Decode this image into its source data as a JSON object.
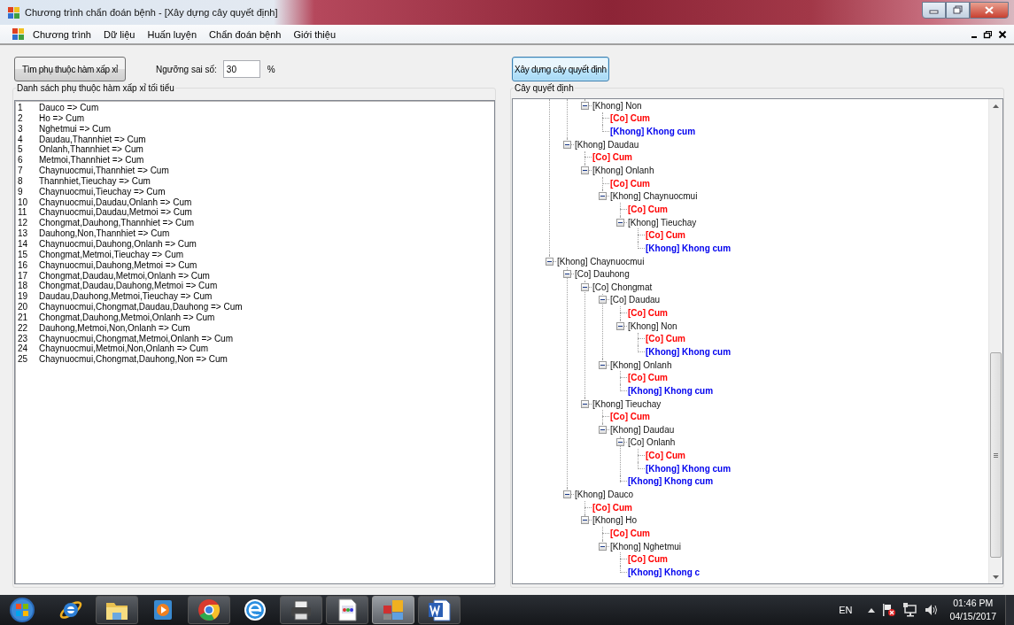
{
  "window": {
    "title": "Chương trình chẩn đoán bệnh - [Xây dựng cây quyết định]"
  },
  "menu": [
    "Chương trình",
    "Dữ liệu",
    "Huấn luyện",
    "Chẩn đoán bệnh",
    "Giới thiệu"
  ],
  "toolbar": {
    "find_button": "Tìm phụ thuộc hàm xấp xỉ",
    "threshold_label": "Ngưỡng sai số:",
    "threshold_value": "30",
    "unit": "%",
    "build_button": "Xây dựng cây quyết định"
  },
  "dependency_list": {
    "title": "Danh sách phụ thuộc hàm xấp xỉ tối tiểu",
    "rows": [
      {
        "number": "1",
        "text": "Dauco => Cum"
      },
      {
        "number": "2",
        "text": "Ho => Cum"
      },
      {
        "number": "3",
        "text": "Nghetmui => Cum"
      },
      {
        "number": "4",
        "text": "Daudau,Thannhiet => Cum"
      },
      {
        "number": "5",
        "text": "Onlanh,Thannhiet => Cum"
      },
      {
        "number": "6",
        "text": "Metmoi,Thannhiet => Cum"
      },
      {
        "number": "7",
        "text": "Chaynuocmui,Thannhiet => Cum"
      },
      {
        "number": "8",
        "text": "Thannhiet,Tieuchay => Cum"
      },
      {
        "number": "9",
        "text": "Chaynuocmui,Tieuchay => Cum"
      },
      {
        "number": "10",
        "text": "Chaynuocmui,Daudau,Onlanh => Cum"
      },
      {
        "number": "11",
        "text": "Chaynuocmui,Daudau,Metmoi => Cum"
      },
      {
        "number": "12",
        "text": "Chongmat,Dauhong,Thannhiet => Cum"
      },
      {
        "number": "13",
        "text": "Dauhong,Non,Thannhiet => Cum"
      },
      {
        "number": "14",
        "text": "Chaynuocmui,Dauhong,Onlanh => Cum"
      },
      {
        "number": "15",
        "text": "Chongmat,Metmoi,Tieuchay => Cum"
      },
      {
        "number": "16",
        "text": "Chaynuocmui,Dauhong,Metmoi => Cum"
      },
      {
        "number": "17",
        "text": "Chongmat,Daudau,Metmoi,Onlanh => Cum"
      },
      {
        "number": "18",
        "text": "Chongmat,Daudau,Dauhong,Metmoi => Cum"
      },
      {
        "number": "19",
        "text": "Daudau,Dauhong,Metmoi,Tieuchay => Cum"
      },
      {
        "number": "20",
        "text": "Chaynuocmui,Chongmat,Daudau,Dauhong => Cum"
      },
      {
        "number": "21",
        "text": "Chongmat,Dauhong,Metmoi,Onlanh => Cum"
      },
      {
        "number": "22",
        "text": "Dauhong,Metmoi,Non,Onlanh => Cum"
      },
      {
        "number": "23",
        "text": "Chaynuocmui,Chongmat,Metmoi,Onlanh => Cum"
      },
      {
        "number": "24",
        "text": "Chaynuocmui,Metmoi,Non,Onlanh => Cum"
      },
      {
        "number": "25",
        "text": "Chaynuocmui,Chongmat,Dauhong,Non => Cum"
      }
    ]
  },
  "decision_tree": {
    "title": "Cây quyết định",
    "nodes": [
      {
        "children": [
          {
            "children": [
              {
                "children": [
                  {
                    "label": "[Khong] Non",
                    "kind": "branch",
                    "expanded": true,
                    "children": [
                      {
                        "label": "[Co] Cum",
                        "kind": "yes"
                      },
                      {
                        "label": "[Khong] Khong cum",
                        "kind": "no"
                      }
                    ]
                  }
                ]
              },
              {
                "label": "[Khong] Daudau",
                "kind": "branch",
                "expanded": true,
                "children": [
                  {
                    "label": "[Co] Cum",
                    "kind": "yes"
                  },
                  {
                    "label": "[Khong] Onlanh",
                    "kind": "branch",
                    "expanded": true,
                    "children": [
                      {
                        "label": "[Co] Cum",
                        "kind": "yes"
                      },
                      {
                        "label": "[Khong] Chaynuocmui",
                        "kind": "branch",
                        "expanded": true,
                        "children": [
                          {
                            "label": "[Co] Cum",
                            "kind": "yes"
                          },
                          {
                            "label": "[Khong] Tieuchay",
                            "kind": "branch",
                            "expanded": true,
                            "children": [
                              {
                                "label": "[Co] Cum",
                                "kind": "yes"
                              },
                              {
                                "label": "[Khong] Khong cum",
                                "kind": "no"
                              }
                            ]
                          }
                        ]
                      }
                    ]
                  }
                ]
              }
            ]
          },
          {
            "label": "[Khong] Chaynuocmui",
            "kind": "branch",
            "expanded": true,
            "children": [
              {
                "label": "[Co] Dauhong",
                "kind": "branch",
                "expanded": true,
                "children": [
                  {
                    "label": "[Co] Chongmat",
                    "kind": "branch",
                    "expanded": true,
                    "children": [
                      {
                        "label": "[Co] Daudau",
                        "kind": "branch",
                        "expanded": true,
                        "children": [
                          {
                            "label": "[Co] Cum",
                            "kind": "yes"
                          },
                          {
                            "label": "[Khong] Non",
                            "kind": "branch",
                            "expanded": true,
                            "children": [
                              {
                                "label": "[Co] Cum",
                                "kind": "yes"
                              },
                              {
                                "label": "[Khong] Khong cum",
                                "kind": "no"
                              }
                            ]
                          }
                        ]
                      },
                      {
                        "label": "[Khong] Onlanh",
                        "kind": "branch",
                        "expanded": true,
                        "children": [
                          {
                            "label": "[Co] Cum",
                            "kind": "yes"
                          },
                          {
                            "label": "[Khong] Khong cum",
                            "kind": "no"
                          }
                        ]
                      }
                    ]
                  },
                  {
                    "label": "[Khong] Tieuchay",
                    "kind": "branch",
                    "expanded": true,
                    "children": [
                      {
                        "label": "[Co] Cum",
                        "kind": "yes"
                      },
                      {
                        "label": "[Khong] Daudau",
                        "kind": "branch",
                        "expanded": true,
                        "children": [
                          {
                            "label": "[Co] Onlanh",
                            "kind": "branch",
                            "expanded": true,
                            "children": [
                              {
                                "label": "[Co] Cum",
                                "kind": "yes"
                              },
                              {
                                "label": "[Khong] Khong cum",
                                "kind": "no"
                              }
                            ]
                          },
                          {
                            "label": "[Khong] Khong cum",
                            "kind": "no"
                          }
                        ]
                      }
                    ]
                  }
                ]
              },
              {
                "label": "[Khong] Dauco",
                "kind": "branch",
                "expanded": true,
                "children": [
                  {
                    "label": "[Co] Cum",
                    "kind": "yes"
                  },
                  {
                    "label": "[Khong] Ho",
                    "kind": "branch",
                    "expanded": true,
                    "children": [
                      {
                        "label": "[Co] Cum",
                        "kind": "yes"
                      },
                      {
                        "label": "[Khong] Nghetmui",
                        "kind": "branch",
                        "expanded": true,
                        "children": [
                          {
                            "label": "[Co] Cum",
                            "kind": "yes"
                          },
                          {
                            "label": "[Khong] Khong c",
                            "kind": "no"
                          }
                        ]
                      }
                    ]
                  }
                ]
              }
            ]
          }
        ]
      }
    ]
  },
  "taskbar": {
    "apps": [
      {
        "kind": "ie",
        "running": false,
        "selected": false
      },
      {
        "kind": "folder",
        "running": true,
        "selected": false
      },
      {
        "kind": "media",
        "running": false,
        "selected": false
      },
      {
        "kind": "chrome",
        "running": true,
        "selected": false
      },
      {
        "kind": "edge",
        "running": false,
        "selected": false
      },
      {
        "kind": "printer",
        "running": true,
        "selected": false
      },
      {
        "kind": "image",
        "running": true,
        "selected": false
      },
      {
        "kind": "squares",
        "running": true,
        "selected": true
      },
      {
        "kind": "word",
        "running": true,
        "selected": false
      }
    ],
    "language": "EN",
    "time": "01:46 PM",
    "date": "04/15/2017"
  }
}
